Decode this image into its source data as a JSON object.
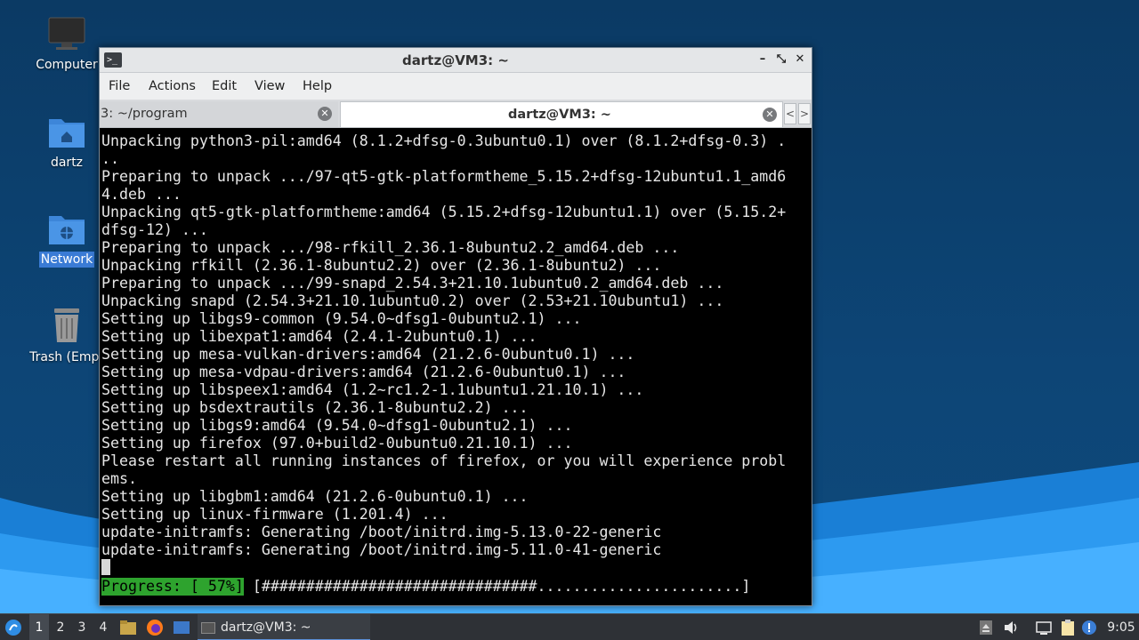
{
  "desktop": {
    "icons": [
      {
        "label": "Computer",
        "icon": "monitor-icon"
      },
      {
        "label": "dartz",
        "icon": "home-folder-icon"
      },
      {
        "label": "Network",
        "icon": "network-folder-icon"
      },
      {
        "label": "Trash (Empt",
        "icon": "trash-icon"
      }
    ]
  },
  "window": {
    "title": "dartz@VM3: ~",
    "controls": {
      "minimize": "–",
      "maximize": "⤡",
      "close": "✕"
    },
    "menu": [
      "File",
      "Actions",
      "Edit",
      "View",
      "Help"
    ],
    "tabs": [
      {
        "label": "3: ~/program",
        "active": false
      },
      {
        "label": "dartz@VM3: ~",
        "active": true
      }
    ],
    "tab_scroll": {
      "left": "<",
      "right": ">"
    }
  },
  "terminal": {
    "lines": [
      "Unpacking python3-pil:amd64 (8.1.2+dfsg-0.3ubuntu0.1) over (8.1.2+dfsg-0.3) .",
      "..",
      "Preparing to unpack .../97-qt5-gtk-platformtheme_5.15.2+dfsg-12ubuntu1.1_amd6",
      "4.deb ...",
      "Unpacking qt5-gtk-platformtheme:amd64 (5.15.2+dfsg-12ubuntu1.1) over (5.15.2+",
      "dfsg-12) ...",
      "Preparing to unpack .../98-rfkill_2.36.1-8ubuntu2.2_amd64.deb ...",
      "Unpacking rfkill (2.36.1-8ubuntu2.2) over (2.36.1-8ubuntu2) ...",
      "Preparing to unpack .../99-snapd_2.54.3+21.10.1ubuntu0.2_amd64.deb ...",
      "Unpacking snapd (2.54.3+21.10.1ubuntu0.2) over (2.53+21.10ubuntu1) ...",
      "Setting up libgs9-common (9.54.0~dfsg1-0ubuntu2.1) ...",
      "Setting up libexpat1:amd64 (2.4.1-2ubuntu0.1) ...",
      "Setting up mesa-vulkan-drivers:amd64 (21.2.6-0ubuntu0.1) ...",
      "Setting up mesa-vdpau-drivers:amd64 (21.2.6-0ubuntu0.1) ...",
      "Setting up libspeex1:amd64 (1.2~rc1.2-1.1ubuntu1.21.10.1) ...",
      "Setting up bsdextrautils (2.36.1-8ubuntu2.2) ...",
      "Setting up libgs9:amd64 (9.54.0~dfsg1-0ubuntu2.1) ...",
      "Setting up firefox (97.0+build2-0ubuntu0.21.10.1) ...",
      "Please restart all running instances of firefox, or you will experience probl",
      "ems.",
      "Setting up libgbm1:amd64 (21.2.6-0ubuntu0.1) ...",
      "Setting up linux-firmware (1.201.4) ...",
      "update-initramfs: Generating /boot/initrd.img-5.13.0-22-generic",
      "update-initramfs: Generating /boot/initrd.img-5.11.0-41-generic"
    ],
    "progress": {
      "label": "Progress: [ 57%]",
      "bar": " [###############################.......................]",
      "percent": 57
    }
  },
  "taskbar": {
    "workspaces": [
      "1",
      "2",
      "3",
      "4"
    ],
    "current_workspace": "1",
    "task": "dartz@VM3: ~",
    "clock": "9:05"
  },
  "colors": {
    "progress_green": "#2ea32e",
    "selection_blue": "#3a7bd5"
  }
}
